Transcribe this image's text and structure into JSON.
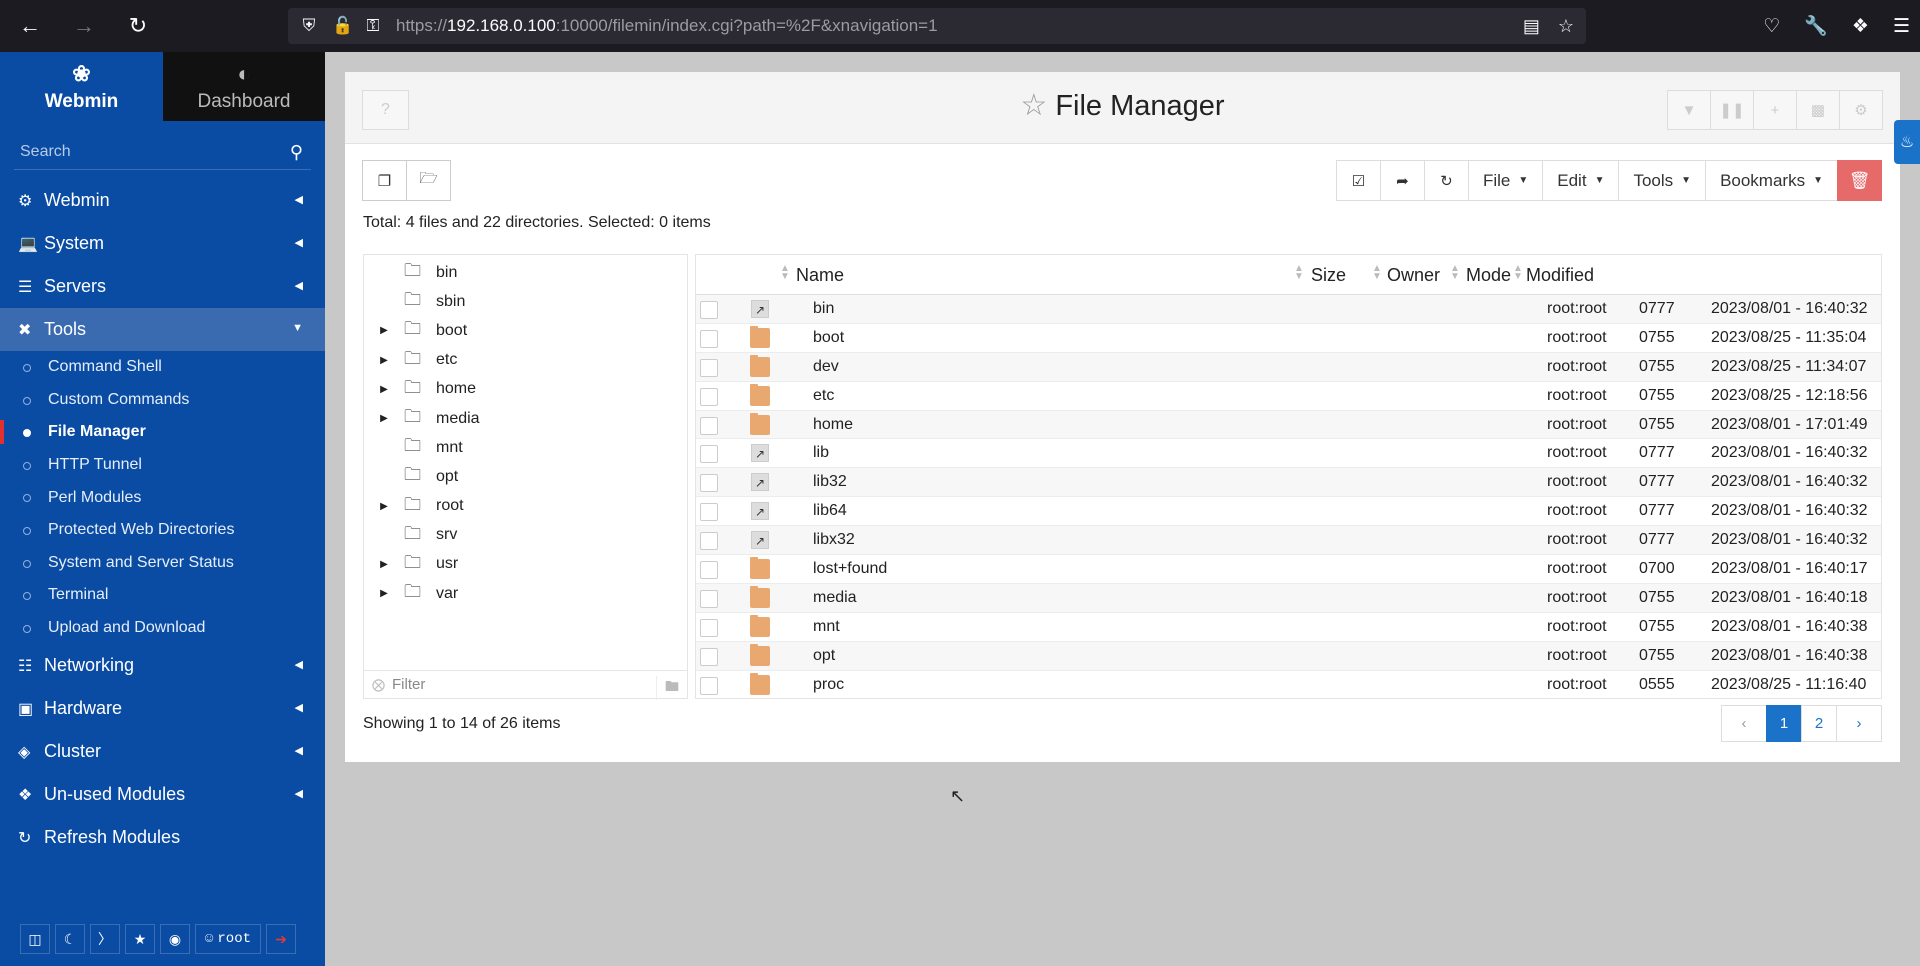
{
  "browser": {
    "url_prefix": "https://",
    "url_host": "192.168.0.100",
    "url_rest": ":10000/filemin/index.cgi?path=%2F&xnavigation=1"
  },
  "sidebar": {
    "tabs": [
      {
        "label": "Webmin",
        "icon": "webmin-logo-icon"
      },
      {
        "label": "Dashboard",
        "icon": "dashboard-gauge-icon"
      }
    ],
    "search_placeholder": "Search",
    "categories_top": [
      {
        "label": "Webmin",
        "icon": "gear-icon"
      },
      {
        "label": "System",
        "icon": "laptop-icon"
      },
      {
        "label": "Servers",
        "icon": "server-icon"
      },
      {
        "label": "Tools",
        "icon": "tools-icon"
      }
    ],
    "tools_items": [
      "Command Shell",
      "Custom Commands",
      "File Manager",
      "HTTP Tunnel",
      "Perl Modules",
      "Protected Web Directories",
      "System and Server Status",
      "Terminal",
      "Upload and Download"
    ],
    "active_item": "File Manager",
    "categories_bottom": [
      {
        "label": "Networking",
        "icon": "network-icon"
      },
      {
        "label": "Hardware",
        "icon": "hdd-icon"
      },
      {
        "label": "Cluster",
        "icon": "layers-icon"
      },
      {
        "label": "Un-used Modules",
        "icon": "puzzle-icon"
      },
      {
        "label": "Refresh Modules",
        "icon": "refresh-icon"
      }
    ],
    "user": "root"
  },
  "main": {
    "title": "File Manager",
    "toolbar": {
      "file": "File",
      "edit": "Edit",
      "tools": "Tools",
      "bookmarks": "Bookmarks"
    },
    "total": "Total: 4 files and 22 directories. Selected: 0 items",
    "tree": [
      "bin",
      "sbin",
      "boot",
      "etc",
      "home",
      "media",
      "mnt",
      "opt",
      "root",
      "srv",
      "usr",
      "var"
    ],
    "tree_expandable": [
      false,
      false,
      true,
      true,
      true,
      true,
      false,
      false,
      true,
      false,
      true,
      true
    ],
    "filter_placeholder": "Filter",
    "columns": {
      "name": "Name",
      "size": "Size",
      "owner": "Owner",
      "mode": "Mode",
      "modified": "Modified"
    },
    "rows": [
      {
        "name": "bin",
        "type": "link",
        "owner": "root:root",
        "mode": "0777",
        "modified": "2023/08/01 - 16:40:32"
      },
      {
        "name": "boot",
        "type": "folder",
        "owner": "root:root",
        "mode": "0755",
        "modified": "2023/08/25 - 11:35:04"
      },
      {
        "name": "dev",
        "type": "folder",
        "owner": "root:root",
        "mode": "0755",
        "modified": "2023/08/25 - 11:34:07"
      },
      {
        "name": "etc",
        "type": "folder",
        "owner": "root:root",
        "mode": "0755",
        "modified": "2023/08/25 - 12:18:56"
      },
      {
        "name": "home",
        "type": "folder",
        "owner": "root:root",
        "mode": "0755",
        "modified": "2023/08/01 - 17:01:49"
      },
      {
        "name": "lib",
        "type": "link",
        "owner": "root:root",
        "mode": "0777",
        "modified": "2023/08/01 - 16:40:32"
      },
      {
        "name": "lib32",
        "type": "link",
        "owner": "root:root",
        "mode": "0777",
        "modified": "2023/08/01 - 16:40:32"
      },
      {
        "name": "lib64",
        "type": "link",
        "owner": "root:root",
        "mode": "0777",
        "modified": "2023/08/01 - 16:40:32"
      },
      {
        "name": "libx32",
        "type": "link",
        "owner": "root:root",
        "mode": "0777",
        "modified": "2023/08/01 - 16:40:32"
      },
      {
        "name": "lost+found",
        "type": "folder",
        "owner": "root:root",
        "mode": "0700",
        "modified": "2023/08/01 - 16:40:17"
      },
      {
        "name": "media",
        "type": "folder",
        "owner": "root:root",
        "mode": "0755",
        "modified": "2023/08/01 - 16:40:18"
      },
      {
        "name": "mnt",
        "type": "folder",
        "owner": "root:root",
        "mode": "0755",
        "modified": "2023/08/01 - 16:40:38"
      },
      {
        "name": "opt",
        "type": "folder",
        "owner": "root:root",
        "mode": "0755",
        "modified": "2023/08/01 - 16:40:38"
      },
      {
        "name": "proc",
        "type": "folder",
        "owner": "root:root",
        "mode": "0555",
        "modified": "2023/08/25 - 11:16:40"
      }
    ],
    "showing": "Showing 1 to 14 of 26 items",
    "pages": [
      "1",
      "2"
    ],
    "current_page": "1"
  },
  "colors": {
    "sidebar": "#0a4ca3",
    "accent": "#1a73c9",
    "danger": "#e66a6a",
    "folder": "#e8a870"
  }
}
